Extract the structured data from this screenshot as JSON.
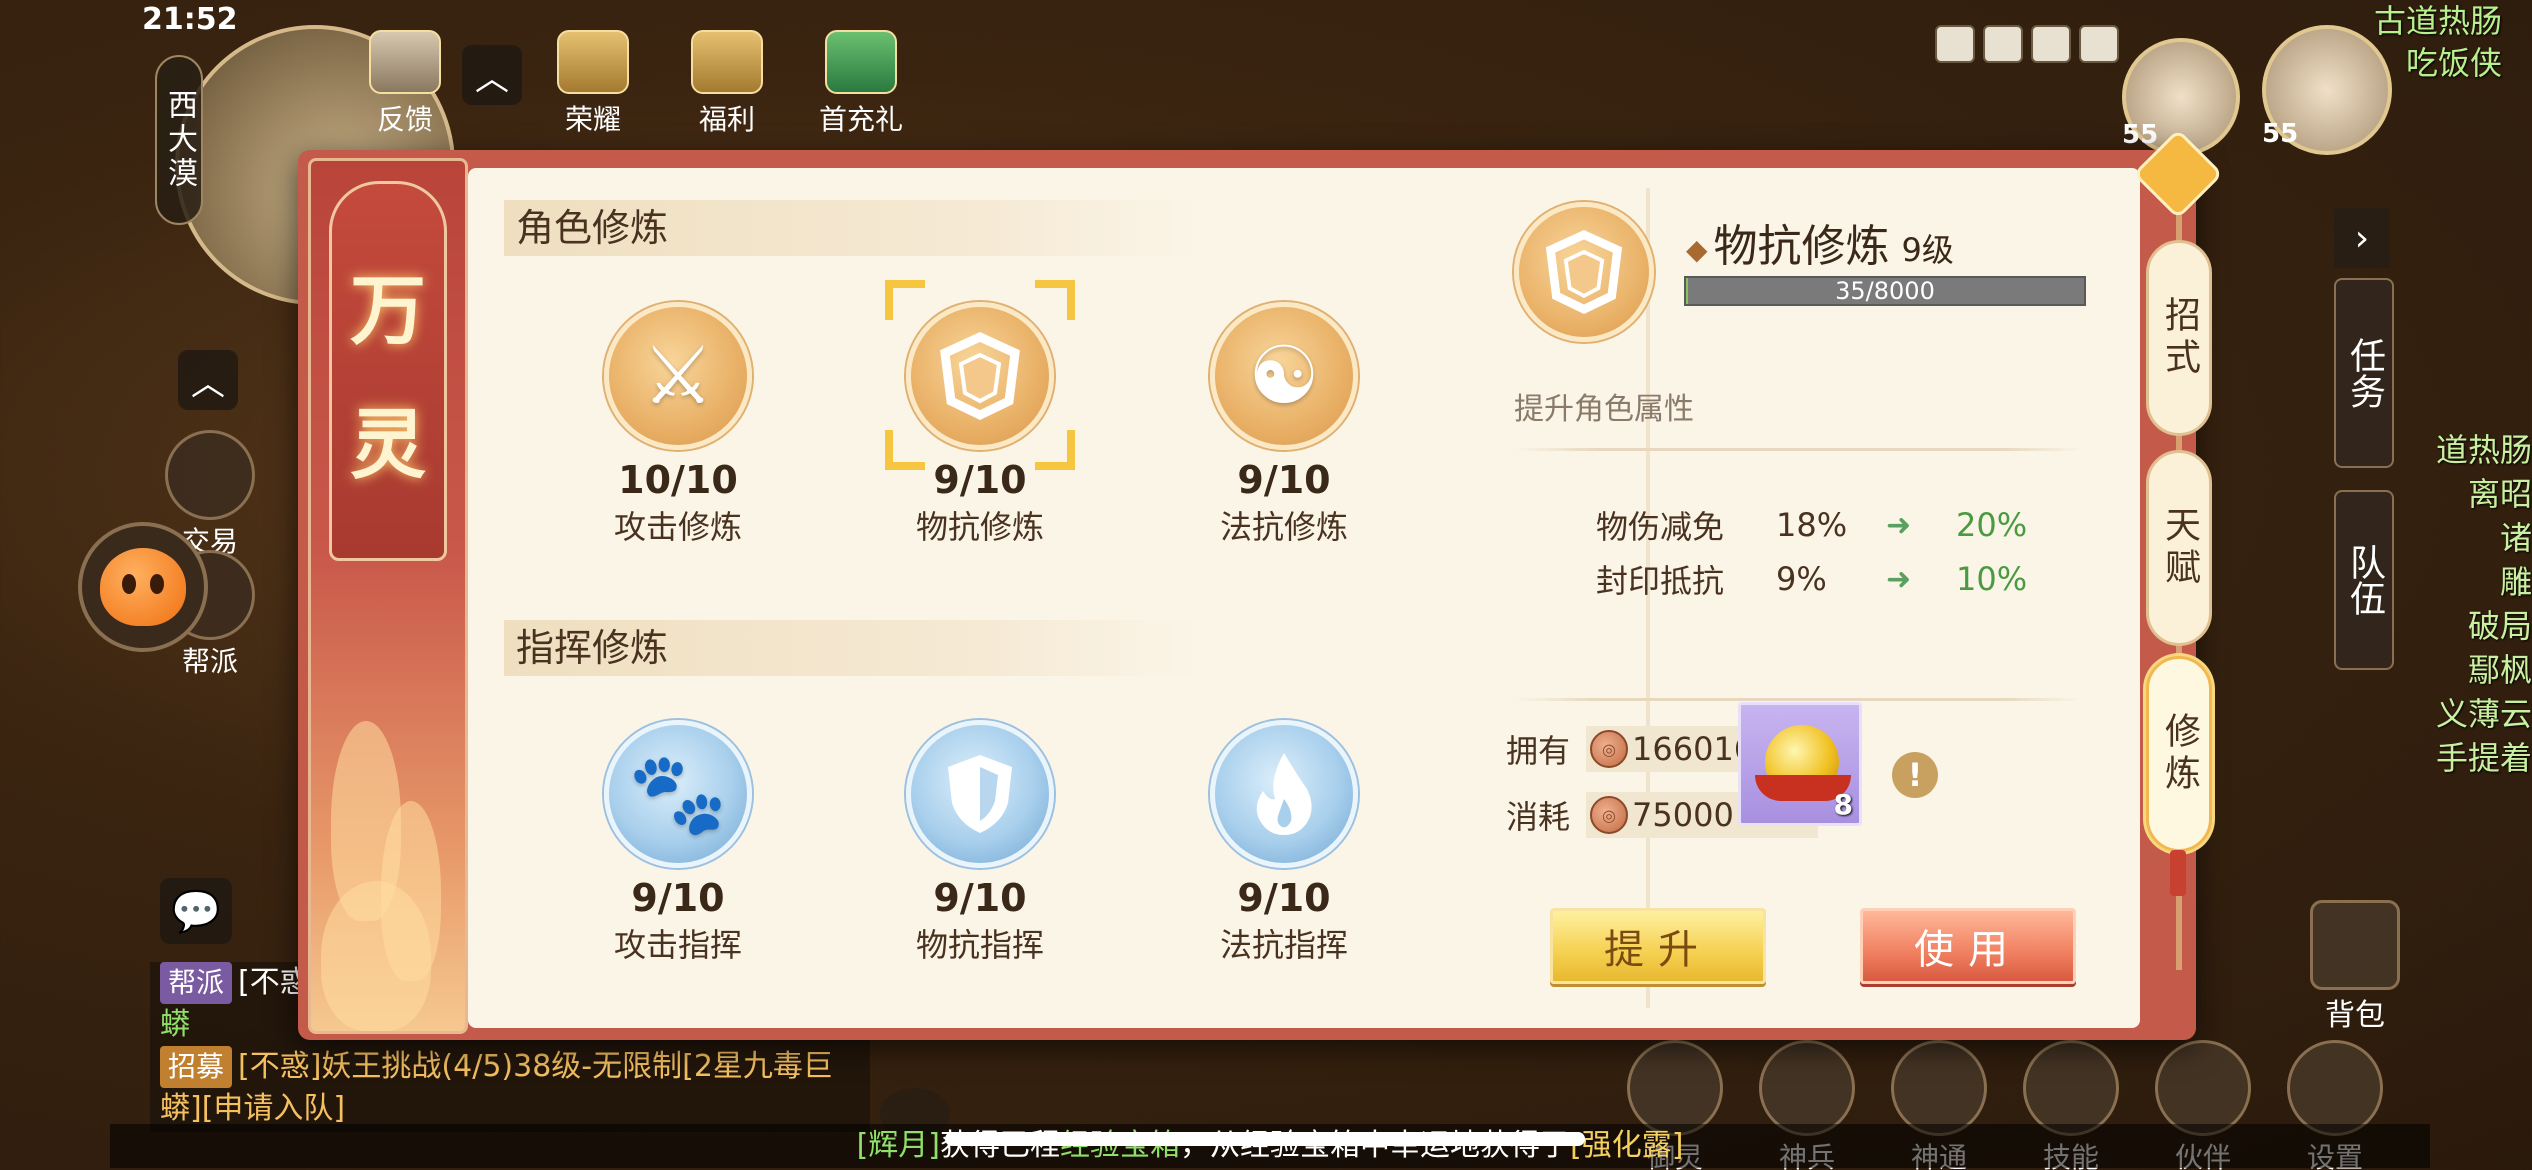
{
  "hud": {
    "clock": "21:52",
    "location": "西大漠",
    "top_icons": [
      {
        "name": "feedback",
        "label": "反馈"
      },
      {
        "name": "honor",
        "label": "荣耀"
      },
      {
        "name": "welfare",
        "label": "福利"
      },
      {
        "name": "first_charge",
        "label": "首充礼"
      }
    ],
    "left_side": [
      {
        "name": "trade",
        "label": "交易"
      },
      {
        "name": "guild",
        "label": "帮派"
      }
    ],
    "chat": [
      {
        "tag": "帮派",
        "text": "[不惑]",
        "extra": "蟒"
      },
      {
        "tag": "招募",
        "text": "[不惑]妖王挑战(4/5)38级-无限制[2星九毒巨",
        "extra": "蟒][申请入队]"
      }
    ],
    "top_right_names": [
      "古道热肠",
      "吃饭侠"
    ],
    "avatars": [
      {
        "level": "55"
      },
      {
        "level": "55"
      }
    ],
    "task_tab": "任务",
    "team_tab": "队伍",
    "right_names": [
      "道热肠",
      "离昭",
      "诸",
      "雕",
      "破局",
      "鄢枫",
      "义薄云",
      "手提着"
    ],
    "bottom_bar": [
      {
        "name": "spirit",
        "label": "御灵"
      },
      {
        "name": "weapon",
        "label": "神兵"
      },
      {
        "name": "divine",
        "label": "神通"
      },
      {
        "name": "skill",
        "label": "技能"
      },
      {
        "name": "partner",
        "label": "伙伴"
      },
      {
        "name": "settings",
        "label": "设置"
      }
    ],
    "bag": "背包",
    "ticker": {
      "p1": "[辉月]",
      "p2": "获得已程",
      "p3": "经验宝箱",
      "p4": "，从经验宝箱中幸运地获得了",
      "p5": "[强化露]"
    }
  },
  "dialog": {
    "banner_chars": [
      "万",
      "灵"
    ],
    "section_role": "角色修炼",
    "section_command": "指挥修炼",
    "role_skills": [
      {
        "name": "攻击修炼",
        "value": "10/10",
        "icon": "crossed-swords-icon"
      },
      {
        "name": "物抗修炼",
        "value": "9/10",
        "icon": "shield-icon"
      },
      {
        "name": "法抗修炼",
        "value": "9/10",
        "icon": "yin-yang-icon"
      }
    ],
    "command_skills": [
      {
        "name": "攻击指挥",
        "value": "9/10",
        "icon": "paw-icon"
      },
      {
        "name": "物抗指挥",
        "value": "9/10",
        "icon": "shield-icon"
      },
      {
        "name": "法抗指挥",
        "value": "9/10",
        "icon": "flame-icon"
      }
    ],
    "detail": {
      "title": "物抗修炼",
      "level": "9级",
      "exp_text": "35/8000",
      "exp_fraction": 0.004375,
      "desc": "提升角色属性",
      "stats": [
        {
          "name": "物伤减免",
          "current": "18%",
          "next": "20%"
        },
        {
          "name": "封印抵抗",
          "current": "9%",
          "next": "10%"
        }
      ],
      "own_label": "拥有",
      "own_value": "16601665",
      "cost_label": "消耗",
      "cost_value": "75000",
      "item_count": "8",
      "info": "!",
      "btn_upgrade": "提升",
      "btn_use": "使用"
    },
    "side_tabs": [
      "招式",
      "天赋",
      "修炼"
    ]
  },
  "colors": {
    "frame": "#c45a4a",
    "panel": "#fbf5e8",
    "gold_orb": "#eab36a",
    "blue_orb": "#a8cfec",
    "selector": "#f7c640",
    "stat_up": "#4a9a40"
  }
}
